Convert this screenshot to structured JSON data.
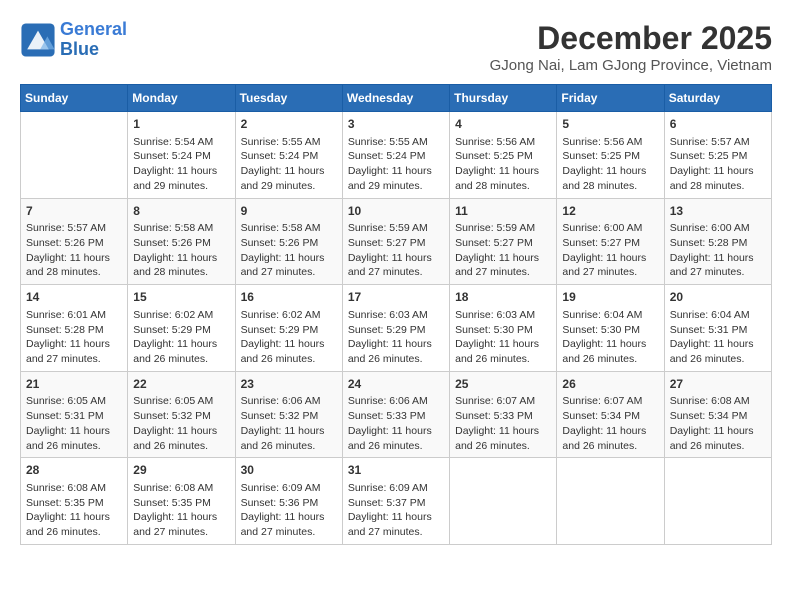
{
  "logo": {
    "line1": "General",
    "line2": "Blue"
  },
  "title": "December 2025",
  "subtitle": "GJong Nai, Lam GJong Province, Vietnam",
  "headers": [
    "Sunday",
    "Monday",
    "Tuesday",
    "Wednesday",
    "Thursday",
    "Friday",
    "Saturday"
  ],
  "weeks": [
    [
      {
        "day": "",
        "sunrise": "",
        "sunset": "",
        "daylight": ""
      },
      {
        "day": "1",
        "sunrise": "Sunrise: 5:54 AM",
        "sunset": "Sunset: 5:24 PM",
        "daylight": "Daylight: 11 hours and 29 minutes."
      },
      {
        "day": "2",
        "sunrise": "Sunrise: 5:55 AM",
        "sunset": "Sunset: 5:24 PM",
        "daylight": "Daylight: 11 hours and 29 minutes."
      },
      {
        "day": "3",
        "sunrise": "Sunrise: 5:55 AM",
        "sunset": "Sunset: 5:24 PM",
        "daylight": "Daylight: 11 hours and 29 minutes."
      },
      {
        "day": "4",
        "sunrise": "Sunrise: 5:56 AM",
        "sunset": "Sunset: 5:25 PM",
        "daylight": "Daylight: 11 hours and 28 minutes."
      },
      {
        "day": "5",
        "sunrise": "Sunrise: 5:56 AM",
        "sunset": "Sunset: 5:25 PM",
        "daylight": "Daylight: 11 hours and 28 minutes."
      },
      {
        "day": "6",
        "sunrise": "Sunrise: 5:57 AM",
        "sunset": "Sunset: 5:25 PM",
        "daylight": "Daylight: 11 hours and 28 minutes."
      }
    ],
    [
      {
        "day": "7",
        "sunrise": "Sunrise: 5:57 AM",
        "sunset": "Sunset: 5:26 PM",
        "daylight": "Daylight: 11 hours and 28 minutes."
      },
      {
        "day": "8",
        "sunrise": "Sunrise: 5:58 AM",
        "sunset": "Sunset: 5:26 PM",
        "daylight": "Daylight: 11 hours and 28 minutes."
      },
      {
        "day": "9",
        "sunrise": "Sunrise: 5:58 AM",
        "sunset": "Sunset: 5:26 PM",
        "daylight": "Daylight: 11 hours and 27 minutes."
      },
      {
        "day": "10",
        "sunrise": "Sunrise: 5:59 AM",
        "sunset": "Sunset: 5:27 PM",
        "daylight": "Daylight: 11 hours and 27 minutes."
      },
      {
        "day": "11",
        "sunrise": "Sunrise: 5:59 AM",
        "sunset": "Sunset: 5:27 PM",
        "daylight": "Daylight: 11 hours and 27 minutes."
      },
      {
        "day": "12",
        "sunrise": "Sunrise: 6:00 AM",
        "sunset": "Sunset: 5:27 PM",
        "daylight": "Daylight: 11 hours and 27 minutes."
      },
      {
        "day": "13",
        "sunrise": "Sunrise: 6:00 AM",
        "sunset": "Sunset: 5:28 PM",
        "daylight": "Daylight: 11 hours and 27 minutes."
      }
    ],
    [
      {
        "day": "14",
        "sunrise": "Sunrise: 6:01 AM",
        "sunset": "Sunset: 5:28 PM",
        "daylight": "Daylight: 11 hours and 27 minutes."
      },
      {
        "day": "15",
        "sunrise": "Sunrise: 6:02 AM",
        "sunset": "Sunset: 5:29 PM",
        "daylight": "Daylight: 11 hours and 26 minutes."
      },
      {
        "day": "16",
        "sunrise": "Sunrise: 6:02 AM",
        "sunset": "Sunset: 5:29 PM",
        "daylight": "Daylight: 11 hours and 26 minutes."
      },
      {
        "day": "17",
        "sunrise": "Sunrise: 6:03 AM",
        "sunset": "Sunset: 5:29 PM",
        "daylight": "Daylight: 11 hours and 26 minutes."
      },
      {
        "day": "18",
        "sunrise": "Sunrise: 6:03 AM",
        "sunset": "Sunset: 5:30 PM",
        "daylight": "Daylight: 11 hours and 26 minutes."
      },
      {
        "day": "19",
        "sunrise": "Sunrise: 6:04 AM",
        "sunset": "Sunset: 5:30 PM",
        "daylight": "Daylight: 11 hours and 26 minutes."
      },
      {
        "day": "20",
        "sunrise": "Sunrise: 6:04 AM",
        "sunset": "Sunset: 5:31 PM",
        "daylight": "Daylight: 11 hours and 26 minutes."
      }
    ],
    [
      {
        "day": "21",
        "sunrise": "Sunrise: 6:05 AM",
        "sunset": "Sunset: 5:31 PM",
        "daylight": "Daylight: 11 hours and 26 minutes."
      },
      {
        "day": "22",
        "sunrise": "Sunrise: 6:05 AM",
        "sunset": "Sunset: 5:32 PM",
        "daylight": "Daylight: 11 hours and 26 minutes."
      },
      {
        "day": "23",
        "sunrise": "Sunrise: 6:06 AM",
        "sunset": "Sunset: 5:32 PM",
        "daylight": "Daylight: 11 hours and 26 minutes."
      },
      {
        "day": "24",
        "sunrise": "Sunrise: 6:06 AM",
        "sunset": "Sunset: 5:33 PM",
        "daylight": "Daylight: 11 hours and 26 minutes."
      },
      {
        "day": "25",
        "sunrise": "Sunrise: 6:07 AM",
        "sunset": "Sunset: 5:33 PM",
        "daylight": "Daylight: 11 hours and 26 minutes."
      },
      {
        "day": "26",
        "sunrise": "Sunrise: 6:07 AM",
        "sunset": "Sunset: 5:34 PM",
        "daylight": "Daylight: 11 hours and 26 minutes."
      },
      {
        "day": "27",
        "sunrise": "Sunrise: 6:08 AM",
        "sunset": "Sunset: 5:34 PM",
        "daylight": "Daylight: 11 hours and 26 minutes."
      }
    ],
    [
      {
        "day": "28",
        "sunrise": "Sunrise: 6:08 AM",
        "sunset": "Sunset: 5:35 PM",
        "daylight": "Daylight: 11 hours and 26 minutes."
      },
      {
        "day": "29",
        "sunrise": "Sunrise: 6:08 AM",
        "sunset": "Sunset: 5:35 PM",
        "daylight": "Daylight: 11 hours and 27 minutes."
      },
      {
        "day": "30",
        "sunrise": "Sunrise: 6:09 AM",
        "sunset": "Sunset: 5:36 PM",
        "daylight": "Daylight: 11 hours and 27 minutes."
      },
      {
        "day": "31",
        "sunrise": "Sunrise: 6:09 AM",
        "sunset": "Sunset: 5:37 PM",
        "daylight": "Daylight: 11 hours and 27 minutes."
      },
      {
        "day": "",
        "sunrise": "",
        "sunset": "",
        "daylight": ""
      },
      {
        "day": "",
        "sunrise": "",
        "sunset": "",
        "daylight": ""
      },
      {
        "day": "",
        "sunrise": "",
        "sunset": "",
        "daylight": ""
      }
    ]
  ]
}
